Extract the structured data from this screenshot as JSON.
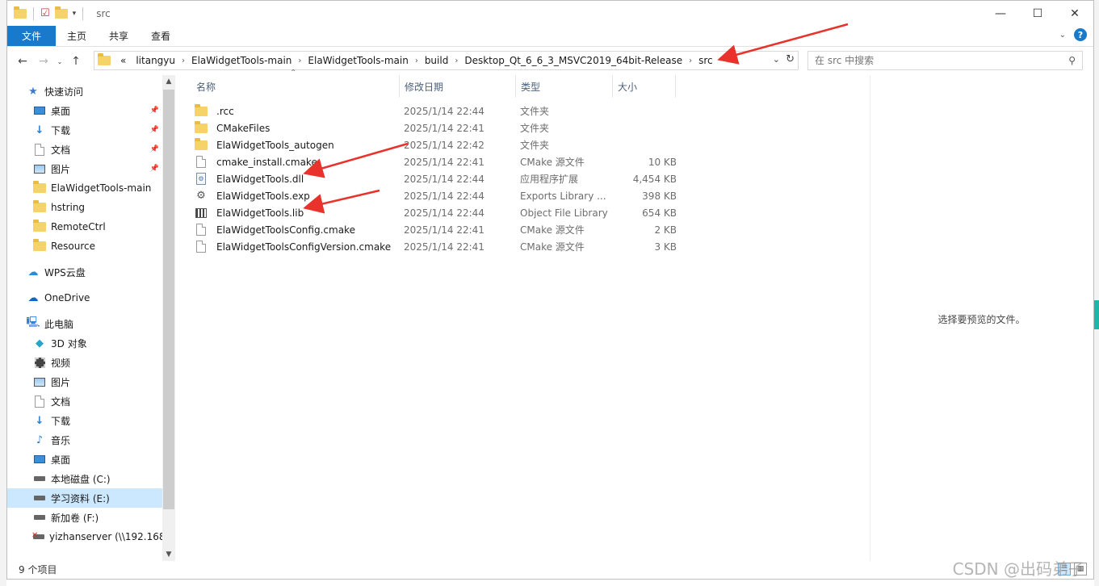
{
  "window": {
    "title": "src",
    "controls": {
      "minimize": "—",
      "maximize": "☐",
      "close": "✕"
    }
  },
  "ribbon": {
    "tabs": [
      "文件",
      "主页",
      "共享",
      "查看"
    ]
  },
  "address": {
    "overflow": "«",
    "crumbs": [
      "litangyu",
      "ElaWidgetTools-main",
      "ElaWidgetTools-main",
      "build",
      "Desktop_Qt_6_6_3_MSVC2019_64bit-Release",
      "src"
    ],
    "search_placeholder": "在 src 中搜索"
  },
  "nav": {
    "quick_access": "快速访问",
    "quick_items": [
      {
        "label": "桌面",
        "icon": "desktop-icon",
        "pinned": true
      },
      {
        "label": "下载",
        "icon": "download-icon",
        "pinned": true
      },
      {
        "label": "文档",
        "icon": "documents-icon",
        "pinned": true
      },
      {
        "label": "图片",
        "icon": "pictures-icon",
        "pinned": true
      },
      {
        "label": "ElaWidgetTools-main",
        "icon": "folder-icon",
        "pinned": false
      },
      {
        "label": "hstring",
        "icon": "folder-icon",
        "pinned": false
      },
      {
        "label": "RemoteCtrl",
        "icon": "folder-icon",
        "pinned": false
      },
      {
        "label": "Resource",
        "icon": "folder-icon",
        "pinned": false
      }
    ],
    "wps": "WPS云盘",
    "onedrive": "OneDrive",
    "this_pc": "此电脑",
    "pc_items": [
      {
        "label": "3D 对象",
        "icon": "3d-objects-icon"
      },
      {
        "label": "视频",
        "icon": "videos-icon"
      },
      {
        "label": "图片",
        "icon": "pictures-icon"
      },
      {
        "label": "文档",
        "icon": "documents-icon"
      },
      {
        "label": "下载",
        "icon": "download-icon"
      },
      {
        "label": "音乐",
        "icon": "music-icon"
      },
      {
        "label": "桌面",
        "icon": "desktop-icon"
      },
      {
        "label": "本地磁盘 (C:)",
        "icon": "drive-icon"
      },
      {
        "label": "学习资料 (E:)",
        "icon": "drive-icon",
        "selected": true
      },
      {
        "label": "新加卷 (F:)",
        "icon": "drive-icon"
      },
      {
        "label": "yizhanserver (\\\\192.168.",
        "icon": "network-drive-icon"
      }
    ]
  },
  "columns": {
    "name": "名称",
    "date": "修改日期",
    "type": "类型",
    "size": "大小"
  },
  "files": [
    {
      "name": ".rcc",
      "date": "2025/1/14 22:44",
      "type": "文件夹",
      "size": "",
      "icon": "folder-icon"
    },
    {
      "name": "CMakeFiles",
      "date": "2025/1/14 22:41",
      "type": "文件夹",
      "size": "",
      "icon": "folder-icon"
    },
    {
      "name": "ElaWidgetTools_autogen",
      "date": "2025/1/14 22:42",
      "type": "文件夹",
      "size": "",
      "icon": "folder-icon"
    },
    {
      "name": "cmake_install.cmake",
      "date": "2025/1/14 22:41",
      "type": "CMake 源文件",
      "size": "10 KB",
      "icon": "file-icon"
    },
    {
      "name": "ElaWidgetTools.dll",
      "date": "2025/1/14 22:44",
      "type": "应用程序扩展",
      "size": "4,454 KB",
      "icon": "dll-icon"
    },
    {
      "name": "ElaWidgetTools.exp",
      "date": "2025/1/14 22:44",
      "type": "Exports Library ...",
      "size": "398 KB",
      "icon": "exp-icon"
    },
    {
      "name": "ElaWidgetTools.lib",
      "date": "2025/1/14 22:44",
      "type": "Object File Library",
      "size": "654 KB",
      "icon": "lib-icon"
    },
    {
      "name": "ElaWidgetToolsConfig.cmake",
      "date": "2025/1/14 22:41",
      "type": "CMake 源文件",
      "size": "2 KB",
      "icon": "file-icon"
    },
    {
      "name": "ElaWidgetToolsConfigVersion.cmake",
      "date": "2025/1/14 22:41",
      "type": "CMake 源文件",
      "size": "3 KB",
      "icon": "file-icon"
    }
  ],
  "preview": {
    "empty_text": "选择要预览的文件。"
  },
  "status": {
    "count": "9 个项目"
  },
  "watermark": "CSDN @出码弟子",
  "colors": {
    "accent": "#1979ca",
    "selection": "#cce8ff",
    "arrow": "#e8322b"
  }
}
